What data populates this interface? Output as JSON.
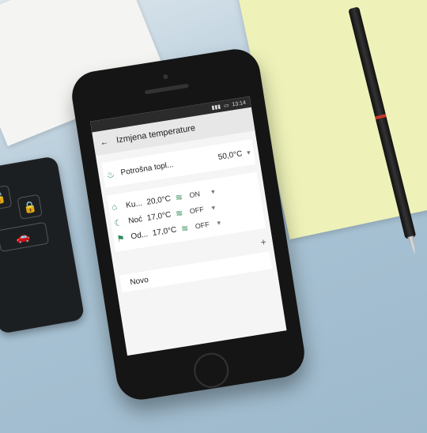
{
  "screen": {
    "status": {
      "time": "13:14"
    },
    "title": "Izmjena temperature",
    "back_icon": "arrow-left-icon",
    "boiler": {
      "label": "Potrošna topl...",
      "value": "50,0°C",
      "icon": "water-heater-icon"
    },
    "modes": [
      {
        "label": "Ku...",
        "value": "20,0°C",
        "state": "ON",
        "icon": "home-icon"
      },
      {
        "label": "Noć",
        "value": "17,0°C",
        "state": "OFF",
        "icon": "moon-icon"
      },
      {
        "label": "Od...",
        "value": "17,0°C",
        "state": "OFF",
        "icon": "away-icon"
      }
    ],
    "add_icon": "plus-icon",
    "new_label": "Novo"
  },
  "scene": {
    "accent": "#2e8b57",
    "surface": "#a9c3d4",
    "notebook_color": "#eef2b8"
  }
}
